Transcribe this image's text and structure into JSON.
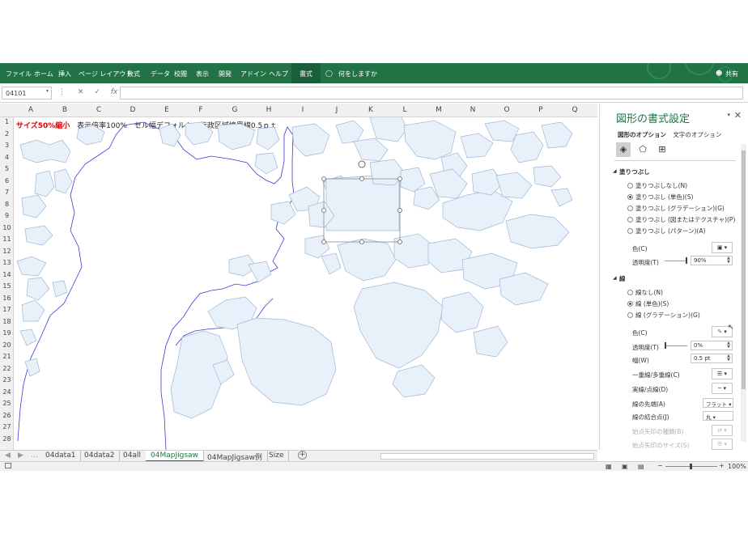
{
  "ribbon": {
    "tabs": [
      "ファイル",
      "ホーム",
      "挿入",
      "ページ レイアウト",
      "数式",
      "データ",
      "校閲",
      "表示",
      "開発",
      "アドイン",
      "ヘルプ"
    ],
    "active_tab": "書式",
    "tell_me": "何をしますか",
    "share": "共有"
  },
  "formula_bar": {
    "name_box": "04101",
    "fx": "fx"
  },
  "grid": {
    "columns": [
      "A",
      "B",
      "C",
      "D",
      "E",
      "F",
      "G",
      "H",
      "I",
      "J",
      "K",
      "L",
      "M",
      "N",
      "O",
      "P",
      "Q"
    ],
    "rows": [
      "1",
      "2",
      "3",
      "4",
      "5",
      "6",
      "7",
      "8",
      "9",
      "10",
      "11",
      "12",
      "13",
      "14",
      "15",
      "16",
      "17",
      "18",
      "19",
      "20",
      "21",
      "22",
      "23",
      "24",
      "25",
      "26",
      "27",
      "28"
    ],
    "a1_red": "サイズ50%縮小",
    "a1_rest": "表示倍率100%　セル幅デフォルト　行政区域境界線0.5ｐｔ"
  },
  "sheet_tabs": [
    "04data1",
    "04data2",
    "04all",
    "04MapJigsaw",
    "04MapJigsaw例",
    "Size"
  ],
  "active_sheet": "04MapJigsaw",
  "status": {
    "zoom": "100%"
  },
  "pane": {
    "title": "図形の書式設定",
    "tab_shape": "図形のオプション",
    "tab_text": "文字のオプション",
    "fill_section": "塗りつぶし",
    "fill_options": [
      "塗りつぶしなし(N)",
      "塗りつぶし (単色)(S)",
      "塗りつぶし (グラデーション)(G)",
      "塗りつぶし (図またはテクスチャ)(P)",
      "塗りつぶし (パターン)(A)"
    ],
    "fill_selected": 1,
    "fill_color_label": "色(C)",
    "fill_transparency_label": "透明度(T)",
    "fill_transparency_value": "90%",
    "line_section": "線",
    "line_options": [
      "線なし(N)",
      "線 (単色)(S)",
      "線 (グラデーション)(G)"
    ],
    "line_selected": 1,
    "line_color_label": "色(C)",
    "line_transparency_label": "透明度(T)",
    "line_transparency_value": "0%",
    "width_label": "幅(W)",
    "width_value": "0.5 pt",
    "compound_label": "一重線/多重線(C)",
    "dash_label": "実線/点線(D)",
    "cap_label": "線の先端(A)",
    "cap_value": "フラット",
    "join_label": "線の結合点(J)",
    "join_value": "丸",
    "begin_arrow_type": "始点矢印の種類(B)",
    "begin_arrow_size": "始点矢印のサイズ(S)"
  },
  "colors": {
    "excel_green": "#217346",
    "region_fill": "#e8f1f9",
    "region_stroke": "#9fb7d6",
    "boundary_stroke": "#3a3ad8"
  }
}
